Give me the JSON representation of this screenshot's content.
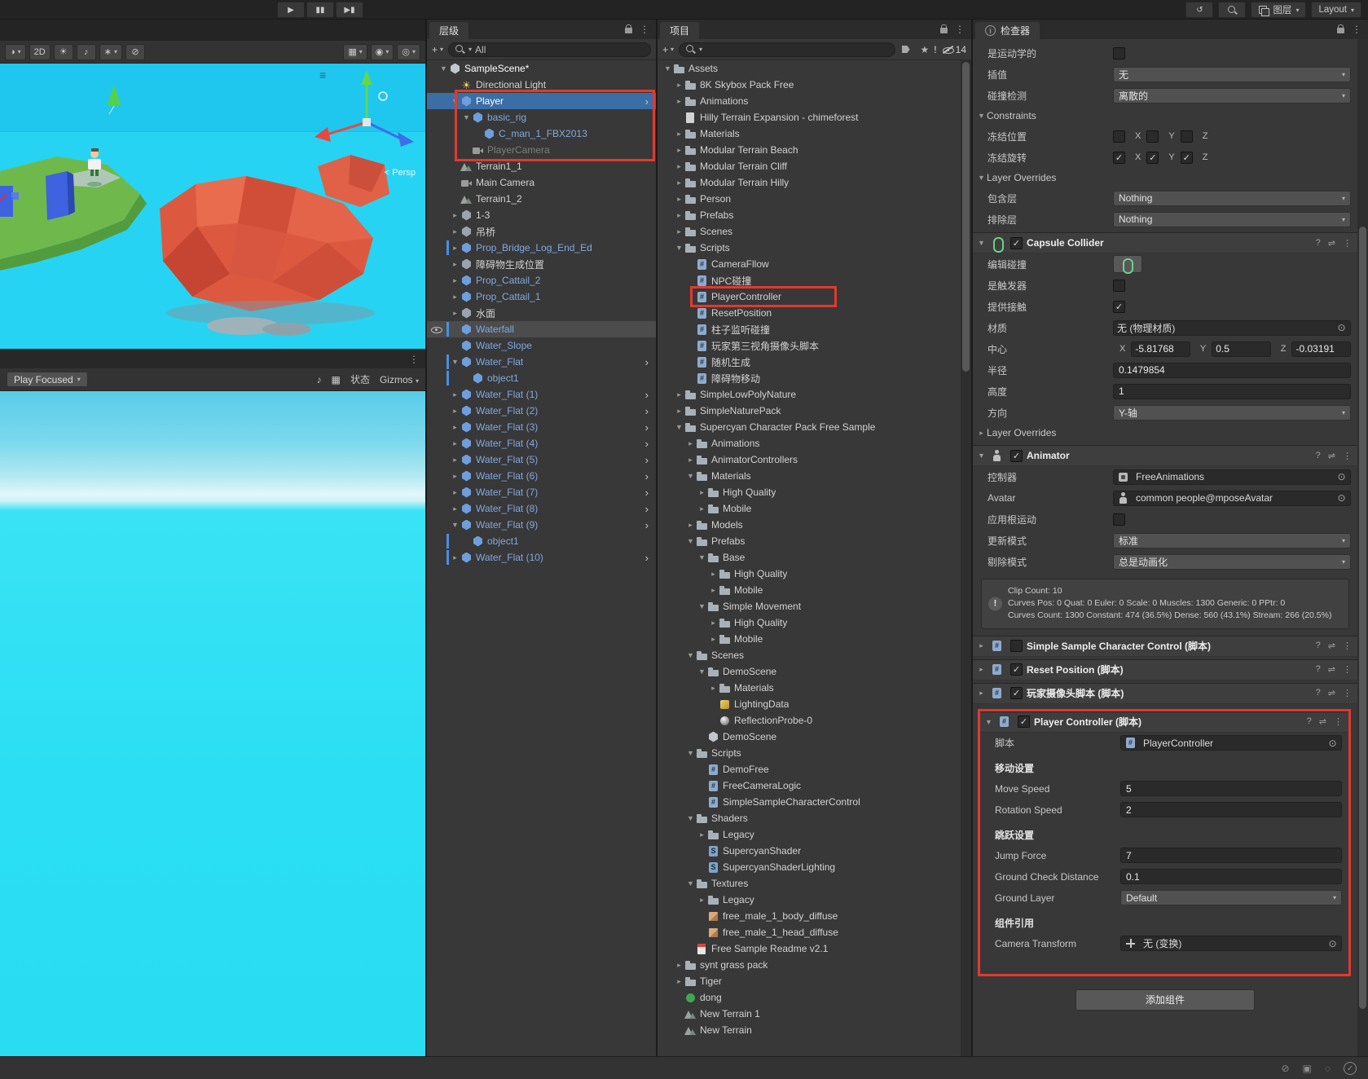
{
  "colors": {
    "annotation_red": "#E2392E",
    "selection_blue": "#3A6EA5",
    "prefab_blue": "#80A9E0",
    "panel_bg": "#383838"
  },
  "topbar": {
    "layers_label": "图层",
    "layout_label": "Layout"
  },
  "scene_view": {
    "mode_2d_label": "2D",
    "persp_label": "< Persp"
  },
  "game_view": {
    "display_mode": "Play Focused",
    "stats_label": "状态",
    "gizmos_label": "Gizmos"
  },
  "hierarchy": {
    "tab_label": "层级",
    "create_label": "+",
    "search_value": "All",
    "rows": [
      {
        "l": "SampleScene*",
        "d": 0,
        "i": "scene",
        "f": "o",
        "c": "w"
      },
      {
        "l": "Directional Light",
        "d": 1,
        "i": "light",
        "f": "",
        "c": "n"
      },
      {
        "l": "Player",
        "d": 1,
        "i": "cubeb",
        "f": "o",
        "c": "w",
        "s": "b",
        "ch": 1
      },
      {
        "l": "basic_rig",
        "d": 2,
        "i": "cubeb",
        "f": "o",
        "c": "p"
      },
      {
        "l": "C_man_1_FBX2013",
        "d": 3,
        "i": "cubeb",
        "f": "",
        "c": "p"
      },
      {
        "l": "PlayerCamera",
        "d": 2,
        "i": "cam",
        "f": "",
        "c": "d"
      },
      {
        "l": "Terrain1_1",
        "d": 1,
        "i": "terr",
        "f": "",
        "c": "n"
      },
      {
        "l": "Main Camera",
        "d": 1,
        "i": "cam",
        "f": "",
        "c": "n"
      },
      {
        "l": "Terrain1_2",
        "d": 1,
        "i": "terr",
        "f": "",
        "c": "n"
      },
      {
        "l": "1-3",
        "d": 1,
        "i": "cube",
        "f": "c",
        "c": "n"
      },
      {
        "l": "吊桥",
        "d": 1,
        "i": "cube",
        "f": "c",
        "c": "n"
      },
      {
        "l": "Prop_Bridge_Log_End_Ed",
        "d": 1,
        "i": "cubeb",
        "f": "c",
        "c": "p",
        "bar": 1
      },
      {
        "l": "障碍物生成位置",
        "d": 1,
        "i": "cube",
        "f": "c",
        "c": "n"
      },
      {
        "l": "Prop_Cattail_2",
        "d": 1,
        "i": "cubeb",
        "f": "c",
        "c": "p"
      },
      {
        "l": "Prop_Cattail_1",
        "d": 1,
        "i": "cubeb",
        "f": "c",
        "c": "p"
      },
      {
        "l": "水面",
        "d": 1,
        "i": "cube",
        "f": "c",
        "c": "n"
      },
      {
        "l": "Waterfall",
        "d": 1,
        "i": "cubeb",
        "f": "",
        "c": "p",
        "s": "g",
        "bar": 1,
        "eye": 1
      },
      {
        "l": "Water_Slope",
        "d": 1,
        "i": "cubeb",
        "f": "",
        "c": "p"
      },
      {
        "l": "Water_Flat",
        "d": 1,
        "i": "cubeb",
        "f": "o",
        "c": "p",
        "bar": 1,
        "ch": 1
      },
      {
        "l": "object1",
        "d": 2,
        "i": "cubeb",
        "f": "",
        "c": "p",
        "bar": 1
      },
      {
        "l": "Water_Flat (1)",
        "d": 1,
        "i": "cubeb",
        "f": "c",
        "c": "p",
        "ch": 1
      },
      {
        "l": "Water_Flat (2)",
        "d": 1,
        "i": "cubeb",
        "f": "c",
        "c": "p",
        "ch": 1
      },
      {
        "l": "Water_Flat (3)",
        "d": 1,
        "i": "cubeb",
        "f": "c",
        "c": "p",
        "ch": 1
      },
      {
        "l": "Water_Flat (4)",
        "d": 1,
        "i": "cubeb",
        "f": "c",
        "c": "p",
        "ch": 1
      },
      {
        "l": "Water_Flat (5)",
        "d": 1,
        "i": "cubeb",
        "f": "c",
        "c": "p",
        "ch": 1
      },
      {
        "l": "Water_Flat (6)",
        "d": 1,
        "i": "cubeb",
        "f": "c",
        "c": "p",
        "ch": 1
      },
      {
        "l": "Water_Flat (7)",
        "d": 1,
        "i": "cubeb",
        "f": "c",
        "c": "p",
        "ch": 1
      },
      {
        "l": "Water_Flat (8)",
        "d": 1,
        "i": "cubeb",
        "f": "c",
        "c": "p",
        "ch": 1
      },
      {
        "l": "Water_Flat (9)",
        "d": 1,
        "i": "cubeb",
        "f": "o",
        "c": "p",
        "ch": 1
      },
      {
        "l": "object1",
        "d": 2,
        "i": "cubeb",
        "f": "",
        "c": "p",
        "bar": 1
      },
      {
        "l": "Water_Flat (10)",
        "d": 1,
        "i": "cubeb",
        "f": "c",
        "c": "p",
        "bar": 1,
        "ch": 1
      }
    ]
  },
  "project": {
    "tab_label": "项目",
    "create_label": "+",
    "hidden_count": "14",
    "rows": [
      {
        "l": "Assets",
        "d": 0,
        "i": "fo",
        "f": "o"
      },
      {
        "l": "8K Skybox Pack Free",
        "d": 1,
        "i": "fo",
        "f": "c"
      },
      {
        "l": "Animations",
        "d": 1,
        "i": "fo",
        "f": "c"
      },
      {
        "l": "Hilly Terrain Expansion - chimeforest",
        "d": 1,
        "i": "pg",
        "f": ""
      },
      {
        "l": "Materials",
        "d": 1,
        "i": "fo",
        "f": "c"
      },
      {
        "l": "Modular Terrain Beach",
        "d": 1,
        "i": "fo",
        "f": "c"
      },
      {
        "l": "Modular Terrain Cliff",
        "d": 1,
        "i": "fo",
        "f": "c"
      },
      {
        "l": "Modular Terrain Hilly",
        "d": 1,
        "i": "fo",
        "f": "c"
      },
      {
        "l": "Person",
        "d": 1,
        "i": "fo",
        "f": "c"
      },
      {
        "l": "Prefabs",
        "d": 1,
        "i": "fo",
        "f": "c"
      },
      {
        "l": "Scenes",
        "d": 1,
        "i": "fo",
        "f": "c"
      },
      {
        "l": "Scripts",
        "d": 1,
        "i": "fo",
        "f": "o"
      },
      {
        "l": "CameraFllow",
        "d": 2,
        "i": "sc",
        "f": ""
      },
      {
        "l": "NPC碰撞",
        "d": 2,
        "i": "sc",
        "f": ""
      },
      {
        "l": "PlayerController",
        "d": 2,
        "i": "sc",
        "f": ""
      },
      {
        "l": "ResetPosition",
        "d": 2,
        "i": "sc",
        "f": ""
      },
      {
        "l": "柱子监听碰撞",
        "d": 2,
        "i": "sc",
        "f": ""
      },
      {
        "l": "玩家第三视角摄像头脚本",
        "d": 2,
        "i": "sc",
        "f": ""
      },
      {
        "l": "随机生成",
        "d": 2,
        "i": "sc",
        "f": ""
      },
      {
        "l": "障碍物移动",
        "d": 2,
        "i": "sc",
        "f": ""
      },
      {
        "l": "SimpleLowPolyNature",
        "d": 1,
        "i": "fo",
        "f": "c"
      },
      {
        "l": "SimpleNaturePack",
        "d": 1,
        "i": "fo",
        "f": "c"
      },
      {
        "l": "Supercyan Character Pack Free Sample",
        "d": 1,
        "i": "fo",
        "f": "o"
      },
      {
        "l": "Animations",
        "d": 2,
        "i": "fo",
        "f": "c"
      },
      {
        "l": "AnimatorControllers",
        "d": 2,
        "i": "fo",
        "f": "c"
      },
      {
        "l": "Materials",
        "d": 2,
        "i": "fo",
        "f": "o"
      },
      {
        "l": "High Quality",
        "d": 3,
        "i": "fo",
        "f": "c"
      },
      {
        "l": "Mobile",
        "d": 3,
        "i": "fo",
        "f": "c"
      },
      {
        "l": "Models",
        "d": 2,
        "i": "fo",
        "f": "c"
      },
      {
        "l": "Prefabs",
        "d": 2,
        "i": "fo",
        "f": "o"
      },
      {
        "l": "Base",
        "d": 3,
        "i": "fo",
        "f": "o"
      },
      {
        "l": "High Quality",
        "d": 4,
        "i": "fo",
        "f": "c"
      },
      {
        "l": "Mobile",
        "d": 4,
        "i": "fo",
        "f": "c"
      },
      {
        "l": "Simple Movement",
        "d": 3,
        "i": "fo",
        "f": "o"
      },
      {
        "l": "High Quality",
        "d": 4,
        "i": "fo",
        "f": "c"
      },
      {
        "l": "Mobile",
        "d": 4,
        "i": "fo",
        "f": "c"
      },
      {
        "l": "Scenes",
        "d": 2,
        "i": "fo",
        "f": "o"
      },
      {
        "l": "DemoScene",
        "d": 3,
        "i": "fo",
        "f": "o"
      },
      {
        "l": "Materials",
        "d": 4,
        "i": "fo",
        "f": "c"
      },
      {
        "l": "LightingData",
        "d": 4,
        "i": "li",
        "f": ""
      },
      {
        "l": "ReflectionProbe-0",
        "d": 4,
        "i": "pr",
        "f": ""
      },
      {
        "l": "DemoScene",
        "d": 3,
        "i": "scn",
        "f": ""
      },
      {
        "l": "Scripts",
        "d": 2,
        "i": "fo",
        "f": "o"
      },
      {
        "l": "DemoFree",
        "d": 3,
        "i": "sc",
        "f": ""
      },
      {
        "l": "FreeCameraLogic",
        "d": 3,
        "i": "sc",
        "f": ""
      },
      {
        "l": "SimpleSampleCharacterControl",
        "d": 3,
        "i": "sc",
        "f": ""
      },
      {
        "l": "Shaders",
        "d": 2,
        "i": "fo",
        "f": "o"
      },
      {
        "l": "Legacy",
        "d": 3,
        "i": "fo",
        "f": "c"
      },
      {
        "l": "SupercyanShader",
        "d": 3,
        "i": "sh",
        "f": ""
      },
      {
        "l": "SupercyanShaderLighting",
        "d": 3,
        "i": "sh",
        "f": ""
      },
      {
        "l": "Textures",
        "d": 2,
        "i": "fo",
        "f": "o"
      },
      {
        "l": "Legacy",
        "d": 3,
        "i": "fo",
        "f": "c"
      },
      {
        "l": "free_male_1_body_diffuse",
        "d": 3,
        "i": "tx",
        "f": ""
      },
      {
        "l": "free_male_1_head_diffuse",
        "d": 3,
        "i": "tx",
        "f": ""
      },
      {
        "l": "Free Sample Readme v2.1",
        "d": 2,
        "i": "rd",
        "f": ""
      },
      {
        "l": "synt grass pack",
        "d": 1,
        "i": "fo",
        "f": "c"
      },
      {
        "l": "Tiger",
        "d": 1,
        "i": "fo",
        "f": "c"
      },
      {
        "l": "dong",
        "d": 1,
        "i": "gn",
        "f": ""
      },
      {
        "l": "New Terrain 1",
        "d": 1,
        "i": "terr",
        "f": ""
      },
      {
        "l": "New Terrain",
        "d": 1,
        "i": "terr",
        "f": ""
      }
    ]
  },
  "inspector": {
    "tab_label": "检查器",
    "add_component_label": "添加组件",
    "rows": [
      {
        "t": "prop",
        "label": "是运动学的",
        "ctl": "check",
        "checked": false
      },
      {
        "t": "prop",
        "label": "插值",
        "ctl": "dd",
        "value": "无"
      },
      {
        "t": "prop",
        "label": "碰撞检测",
        "ctl": "dd",
        "value": "离散的"
      },
      {
        "t": "fold",
        "label": "Constraints",
        "open": true
      },
      {
        "t": "axes",
        "label": "冻结位置",
        "x": false,
        "y": false,
        "z": false
      },
      {
        "t": "axes",
        "label": "冻结旋转",
        "x": true,
        "y": true,
        "z": true
      },
      {
        "t": "fold",
        "label": "Layer Overrides",
        "open": true
      },
      {
        "t": "prop",
        "label": "包含层",
        "ctl": "dd",
        "value": "Nothing"
      },
      {
        "t": "prop",
        "label": "排除层",
        "ctl": "dd",
        "value": "Nothing"
      },
      {
        "t": "comp",
        "label": "Capsule Collider",
        "icon": "capsule",
        "checked": true,
        "open": true
      },
      {
        "t": "prop",
        "label": "编辑碰撞",
        "ctl": "editbtn"
      },
      {
        "t": "prop",
        "label": "是触发器",
        "ctl": "check",
        "checked": false
      },
      {
        "t": "prop",
        "label": "提供接触",
        "ctl": "check",
        "checked": true
      },
      {
        "t": "prop",
        "label": "材质",
        "ctl": "obj",
        "value": "无 (物理材质)"
      },
      {
        "t": "vec3",
        "label": "中心",
        "x": "-5.81768",
        "y": "0.5",
        "z": "-0.03191"
      },
      {
        "t": "prop",
        "label": "半径",
        "ctl": "text",
        "value": "0.1479854"
      },
      {
        "t": "prop",
        "label": "高度",
        "ctl": "text",
        "value": "1"
      },
      {
        "t": "prop",
        "label": "方向",
        "ctl": "dd",
        "value": "Y-轴"
      },
      {
        "t": "fold",
        "label": "Layer Overrides",
        "open": false
      },
      {
        "t": "comp",
        "label": "Animator",
        "icon": "animator",
        "checked": true,
        "open": true
      },
      {
        "t": "prop",
        "label": "控制器",
        "ctl": "obj",
        "value": "FreeAnimations",
        "oicon": "ctrl"
      },
      {
        "t": "prop",
        "label": "Avatar",
        "ctl": "obj",
        "value": "common people@mposeAvatar",
        "oicon": "avatar"
      },
      {
        "t": "prop",
        "label": "应用根运动",
        "ctl": "check",
        "checked": false
      },
      {
        "t": "prop",
        "label": "更新模式",
        "ctl": "dd",
        "value": "标准"
      },
      {
        "t": "prop",
        "label": "剔除模式",
        "ctl": "dd",
        "value": "总是动画化"
      },
      {
        "t": "info",
        "lines": [
          "Clip Count: 10",
          "Curves Pos: 0 Quat: 0 Euler: 0 Scale: 0 Muscles: 1300 Generic: 0 PPtr: 0",
          "Curves Count: 1300 Constant: 474 (36.5%) Dense: 560 (43.1%) Stream: 266 (20.5%)"
        ]
      },
      {
        "t": "comp",
        "label": "Simple Sample Character Control",
        "suffix": "(脚本)",
        "icon": "script",
        "checked": false,
        "open": false
      },
      {
        "t": "comp",
        "label": "Reset Position",
        "suffix": "(脚本)",
        "icon": "script",
        "checked": true,
        "open": false
      },
      {
        "t": "comp",
        "label": "玩家摄像头脚本",
        "suffix": "(脚本)",
        "icon": "script",
        "checked": true,
        "open": false
      },
      {
        "t": "comp",
        "label": "Player Controller",
        "suffix": "(脚本)",
        "icon": "script",
        "checked": true,
        "open": true,
        "red": true
      },
      {
        "t": "prop",
        "label": "脚本",
        "ctl": "obj",
        "value": "PlayerController",
        "oicon": "script"
      },
      {
        "t": "header",
        "label": "移动设置"
      },
      {
        "t": "prop",
        "label": "Move Speed",
        "ctl": "text",
        "value": "5"
      },
      {
        "t": "prop",
        "label": "Rotation Speed",
        "ctl": "text",
        "value": "2"
      },
      {
        "t": "header",
        "label": "跳跃设置"
      },
      {
        "t": "prop",
        "label": "Jump Force",
        "ctl": "text",
        "value": "7"
      },
      {
        "t": "prop",
        "label": "Ground Check Distance",
        "ctl": "text",
        "value": "0.1"
      },
      {
        "t": "prop",
        "label": "Ground Layer",
        "ctl": "dd",
        "value": "Default"
      },
      {
        "t": "header",
        "label": "组件引用"
      },
      {
        "t": "prop",
        "label": "Camera Transform",
        "ctl": "obj",
        "value": "无 (变换)",
        "oicon": "trans"
      }
    ]
  }
}
